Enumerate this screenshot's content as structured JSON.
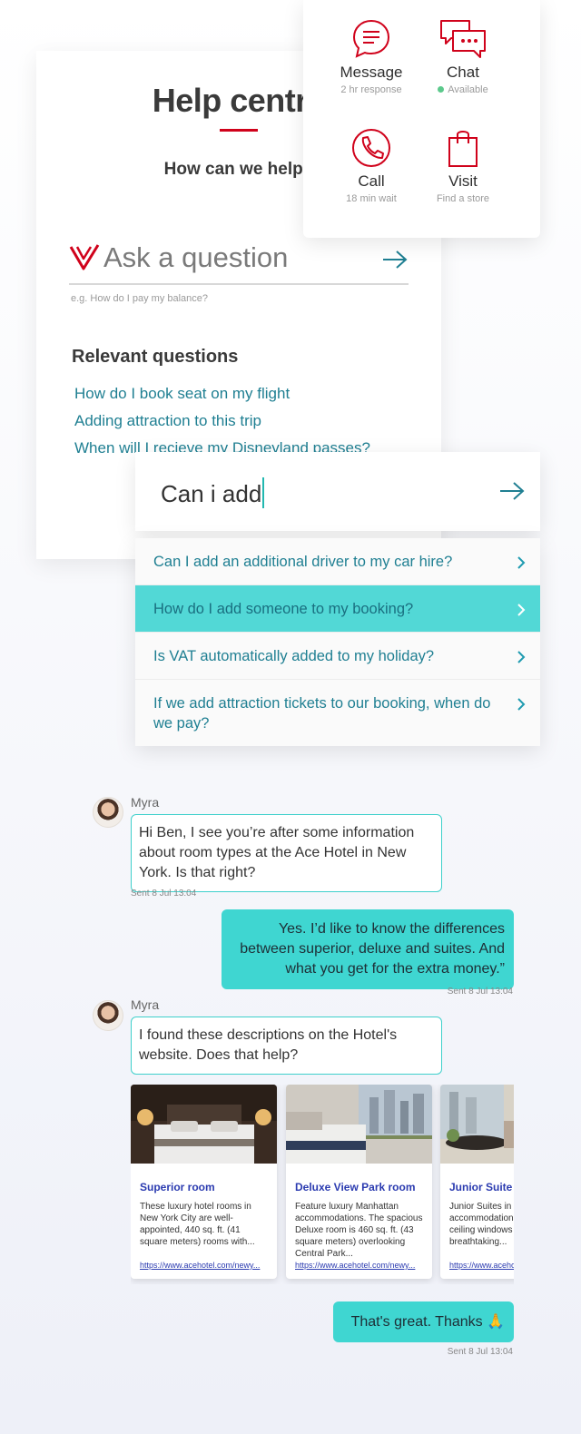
{
  "help": {
    "title": "Help centre",
    "subtitle": "How can we help?",
    "ask_placeholder": "Ask a question",
    "hint": "e.g. How do I pay my balance?",
    "relevant_title": "Relevant questions",
    "relevant": [
      "How do I book seat on my flight",
      "Adding attraction to this trip",
      "When will I recieve my Disneyland passes?"
    ]
  },
  "contact": {
    "items": [
      {
        "icon": "message-icon",
        "label": "Message",
        "sub": "2 hr response"
      },
      {
        "icon": "chat-icon",
        "label": "Chat",
        "sub": "Available"
      },
      {
        "icon": "phone-icon",
        "label": "Call",
        "sub": "18 min wait"
      },
      {
        "icon": "shopping-bag-icon",
        "label": "Visit",
        "sub": "Find a store"
      }
    ]
  },
  "search": {
    "value": "Can i add",
    "suggestions": [
      "Can I add an additional driver to my car hire?",
      "How do I add someone to my booking?",
      "Is VAT automatically added to my holiday?",
      "If we add attraction tickets to our booking, when do we pay?"
    ],
    "active_index": 1
  },
  "chat": {
    "agent_name": "Myra",
    "messages": [
      {
        "from": "agent",
        "text": "Hi Ben, I see you’re after some information about room types at the Ace Hotel in New York. Is that right?",
        "time": "Sent 8 Jul 13:04"
      },
      {
        "from": "user",
        "text": "Yes. I’d like to know the differences between superior, deluxe and suites. And what you get for the extra money.”",
        "time": "Sent 8 Jul 13:04"
      },
      {
        "from": "agent",
        "text": "I found these descriptions on the Hotel's website. Does that help?"
      },
      {
        "from": "user",
        "text": "That's great. Thanks 🙏",
        "time": "Sent 8 Jul 13:04"
      }
    ],
    "rooms": [
      {
        "title": "Superior room",
        "desc": "These luxury hotel rooms in New York City are well-appointed, 440 sq. ft. (41 square meters) rooms with...",
        "url": "https://www.acehotel.com/newy..."
      },
      {
        "title": "Deluxe View Park room",
        "desc": "Feature luxury Manhattan accommodations. The spacious Deluxe room is 460 sq. ft. (43 square meters) overlooking Central Park...",
        "url": "https://www.acehotel.com/newy..."
      },
      {
        "title": "Junior Suite",
        "desc": "Junior Suites in Manhattan are accommodations with floor-to-ceiling windows offering a breathtaking...",
        "url": "https://www.acehotel.com/newy..."
      }
    ]
  },
  "colors": {
    "brand_red": "#d0021b",
    "teal": "#1f7f92",
    "accent_cyan": "#3fd6d1",
    "link_blue": "#2b3bb0"
  }
}
